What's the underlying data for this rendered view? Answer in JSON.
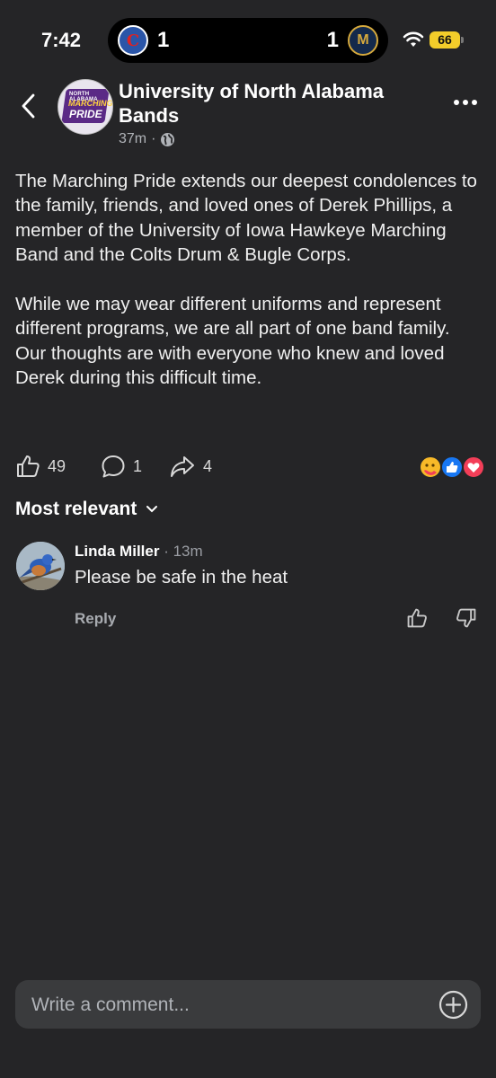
{
  "status": {
    "time": "7:42",
    "scores": {
      "left": "1",
      "right": "1"
    },
    "battery": "66"
  },
  "post": {
    "page_name": "University of North Alabama Bands",
    "avatar_text": {
      "line1": "NORTH ALABAMA",
      "line2": "MARCHING",
      "line3": "PRIDE"
    },
    "time_ago": "37m",
    "separator": "·",
    "paragraphs": [
      "The Marching Pride extends our deepest condolences to the family, friends, and loved ones of Derek Phillips, a member of the University of Iowa Hawkeye Marching Band and the Colts Drum & Bugle Corps.",
      "While we may wear different uniforms and represent different programs, we are all part of one band family. Our thoughts are with everyone who knew and loved Derek during this difficult time."
    ],
    "likes": "49",
    "comments": "1",
    "shares": "4"
  },
  "comments_section": {
    "sort_label": "Most relevant",
    "items": [
      {
        "author": "Linda Miller",
        "time_ago": "· 13m",
        "text": "Please be safe in the heat",
        "reply_label": "Reply"
      }
    ]
  },
  "composer": {
    "placeholder": "Write a comment..."
  },
  "colors": {
    "background": "#252527",
    "secondary_text": "#b0b3b8",
    "like_blue": "#1877f2",
    "love_red": "#f33e58",
    "battery_yellow": "#f3cd2a"
  }
}
